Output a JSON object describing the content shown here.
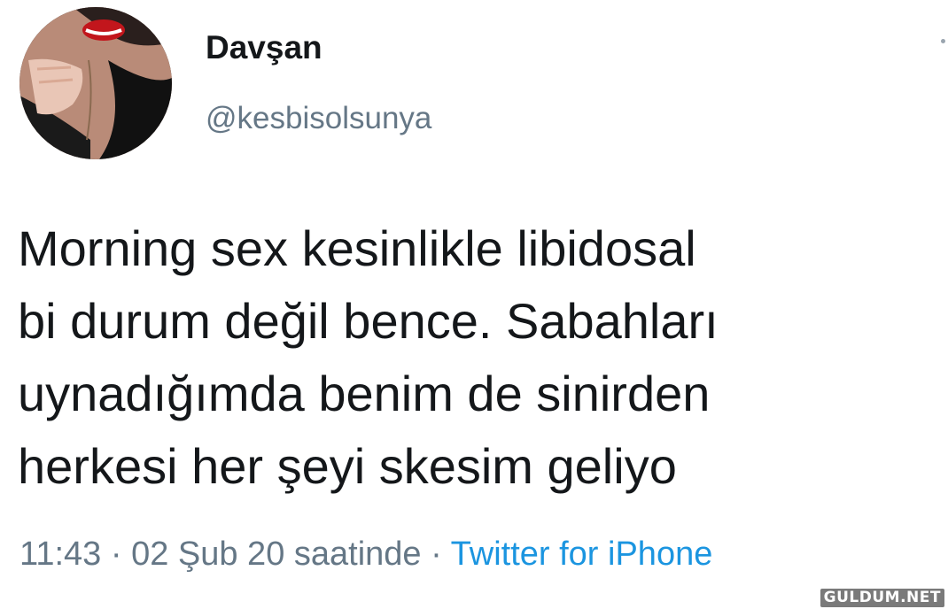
{
  "user": {
    "display_name": "Davşan",
    "handle": "@kesbisolsunya"
  },
  "tweet": {
    "lines": [
      "Morning sex kesinlikle libidosal",
      "bi durum değil bence. Sabahları",
      "uynadığımda benim de sinirden",
      "herkesi her şeyi skesim geliyo"
    ]
  },
  "meta": {
    "time": "11:43",
    "separator": "·",
    "date_text": "02 Şub 20 saatinde",
    "source": "Twitter for iPhone"
  },
  "watermark": "GULDUM.NET",
  "colors": {
    "text": "#14171a",
    "secondary": "#657786",
    "link": "#1b95e0"
  }
}
